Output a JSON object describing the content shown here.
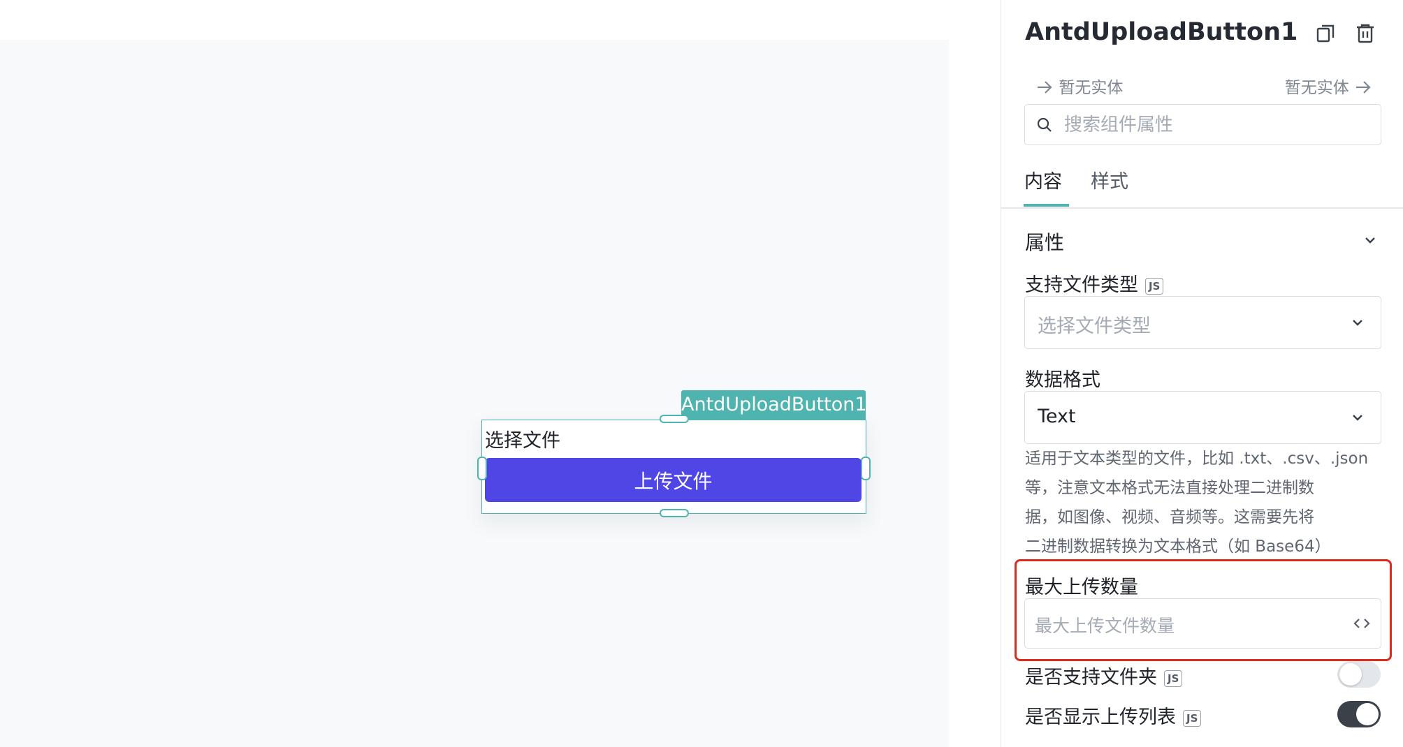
{
  "canvas": {
    "component_tag": "AntdUploadButton1",
    "upload_label": "选择文件",
    "upload_button": "上传文件"
  },
  "panel": {
    "title": "AntdUploadButton1",
    "entity_left": "暂无实体",
    "entity_right": "暂无实体",
    "search_placeholder": "搜索组件属性",
    "tabs": [
      {
        "label": "内容",
        "active": true
      },
      {
        "label": "样式",
        "active": false
      }
    ],
    "section_title": "属性",
    "fields": {
      "file_type": {
        "label": "支持文件类型",
        "badge": "JS",
        "placeholder": "选择文件类型"
      },
      "data_format": {
        "label": "数据格式",
        "value": "Text",
        "help_lines": [
          "适用于文本类型的文件，比如 .txt、.csv、.json",
          "等，注意文本格式无法直接处理二进制数",
          "据，如图像、视频、音频等。这需要先将",
          "二进制数据转换为文本格式（如 Base64）"
        ]
      },
      "max_upload": {
        "label": "最大上传数量",
        "placeholder": "最大上传文件数量"
      },
      "support_folder": {
        "label": "是否支持文件夹",
        "badge": "JS",
        "enabled": false
      },
      "show_list": {
        "label": "是否显示上传列表",
        "badge": "JS",
        "enabled": true
      }
    }
  },
  "colors": {
    "accent_teal": "#4fb4b0",
    "button_primary": "#4f46e5",
    "highlight_red": "#e02a1b",
    "toggle_on": "#3a4149"
  }
}
